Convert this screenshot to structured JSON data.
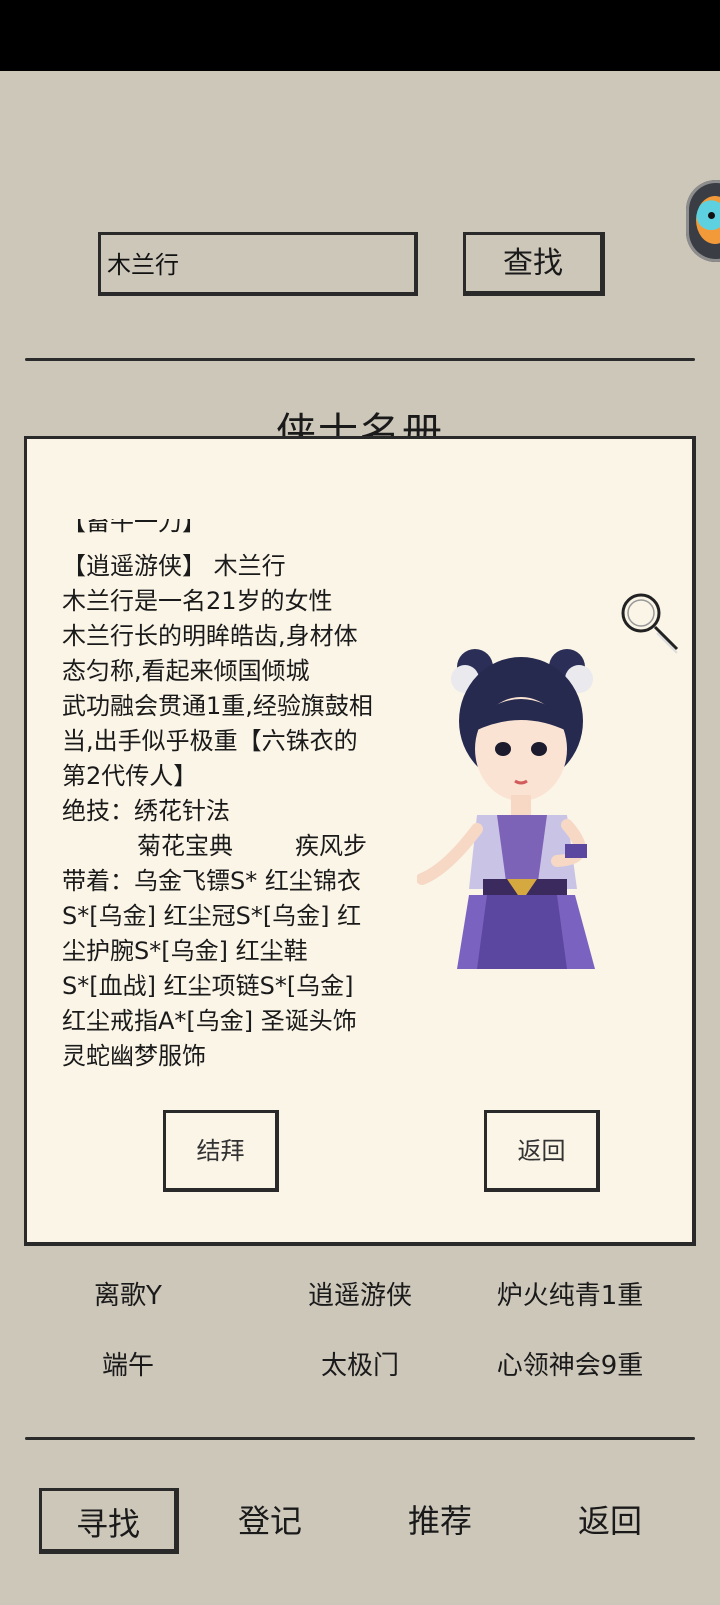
{
  "search": {
    "value": "木兰行",
    "button_label": "查找"
  },
  "roster_title": "侠士名册",
  "profile": {
    "clipped_line": "【畜牛一刀】",
    "lines": [
      "【逍遥游侠】  木兰行",
      "木兰行是一名21岁的女性",
      "木兰行长的明眸皓齿,身材体",
      "态匀称,看起来倾国倾城",
      "武功融会贯通1重,经验旗鼓相",
      "当,出手似乎极重【六铢衣的",
      "第2代传人】",
      "绝技：绣花针法"
    ],
    "skills_row": [
      "菊花宝典",
      "疾风步"
    ],
    "equip_lines": [
      "带着：乌金飞镖S*  红尘锦衣",
      "S*[乌金]  红尘冠S*[乌金]  红",
      "尘护腕S*[乌金]  红尘鞋",
      "S*[血战]  红尘项链S*[乌金]",
      "红尘戒指A*[乌金]  圣诞头饰",
      "灵蛇幽梦服饰"
    ],
    "bond_button": "结拜",
    "back_button": "返回"
  },
  "players": [
    [
      "离歌Y",
      "逍遥游侠",
      "炉火纯青1重"
    ],
    [
      "端午",
      "太极门",
      "心领神会9重"
    ]
  ],
  "tabs": [
    "寻找",
    "登记",
    "推荐",
    "返回"
  ],
  "active_tab": "寻找",
  "icons": {
    "floating": "fish-mascot-icon",
    "inspect": "magnifier-icon",
    "avatar": "character-portrait"
  },
  "colors": {
    "background": "#cdc7ba",
    "card": "#fbf5e8",
    "ink": "#1f1f1f"
  }
}
